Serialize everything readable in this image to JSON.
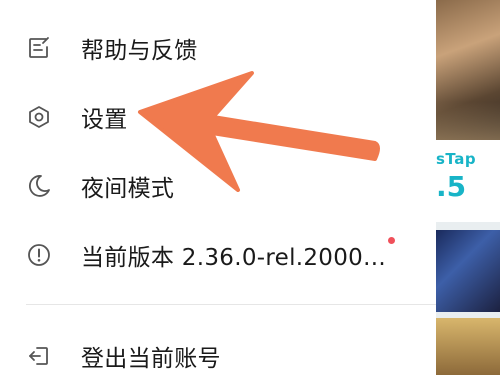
{
  "menu": {
    "items": [
      {
        "label": "帮助与反馈",
        "icon": "feedback-icon"
      },
      {
        "label": "设置",
        "icon": "settings-hexagon-icon"
      },
      {
        "label": "夜间模式",
        "icon": "moon-icon"
      },
      {
        "label": "当前版本 2.36.0-rel.2000...",
        "icon": "info-circle-icon",
        "badge": "red-dot"
      },
      {
        "label": "登出当前账号",
        "icon": "logout-icon"
      }
    ]
  },
  "background_app": {
    "tag": "sTap",
    "number": ".5"
  },
  "colors": {
    "text": "#1a1a1a",
    "icon": "#555555",
    "badge": "#f0505a",
    "divider": "#e6e6e6",
    "annotation_arrow": "#f07a4e",
    "accent_teal": "#18b4c7"
  }
}
